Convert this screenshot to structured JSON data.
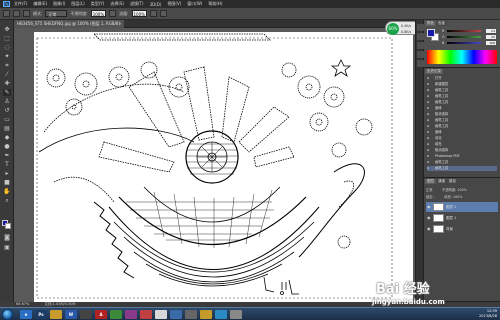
{
  "menubar": {
    "app_icon": "Ps",
    "items": [
      "文件(F)",
      "编辑(E)",
      "图像(I)",
      "图层(L)",
      "类型(Y)",
      "选择(S)",
      "滤镜(T)",
      "3D(D)",
      "视图(V)",
      "窗口(W)",
      "帮助(H)"
    ]
  },
  "options": {
    "label_mode": "模式:",
    "mode_value": "正常",
    "label_opacity": "不透明度:",
    "opacity_value": "100%",
    "label_flow": "流量:",
    "flow_value": "100%"
  },
  "document_tab": {
    "title": "HB3456_ST5 SHEDFNQ.jpg @ 100% (图层 1, RGB/8)",
    "close": "×"
  },
  "status": {
    "zoom": "66.67%",
    "doc_info": "文档:1.03M/3.50M"
  },
  "color_panel": {
    "tabs": [
      "颜色",
      "色板"
    ],
    "sliders": [
      {
        "channel": "R",
        "value": "24",
        "color": "#c04848"
      },
      {
        "channel": "G",
        "value": "20",
        "color": "#48a048"
      },
      {
        "channel": "B",
        "value": "168",
        "color": "#4848c8"
      }
    ]
  },
  "history_panel": {
    "tab": "历史记录",
    "items": [
      {
        "label": "打开",
        "active": false
      },
      {
        "label": "新建图层",
        "active": false
      },
      {
        "label": "画笔工具",
        "active": false
      },
      {
        "label": "画笔工具",
        "active": false
      },
      {
        "label": "画笔工具",
        "active": false
      },
      {
        "label": "魔棒",
        "active": false
      },
      {
        "label": "取消选择",
        "active": false
      },
      {
        "label": "画笔工具",
        "active": false
      },
      {
        "label": "画笔工具",
        "active": false
      },
      {
        "label": "魔棒",
        "active": false
      },
      {
        "label": "羽化",
        "active": false
      },
      {
        "label": "填充",
        "active": false
      },
      {
        "label": "取消选择",
        "active": false
      },
      {
        "label": "Photoshop PDF",
        "active": false
      },
      {
        "label": "画笔工具",
        "active": false
      },
      {
        "label": "画笔工具",
        "active": true
      }
    ]
  },
  "layers_panel": {
    "tabs": [
      "图层",
      "通道",
      "路径"
    ],
    "blend_mode": "正常",
    "opacity_label": "不透明度:",
    "opacity_value": "100%",
    "lock_label": "锁定:",
    "fill_label": "填充:",
    "fill_value": "100%",
    "layers": [
      {
        "name": "图层 2",
        "selected": true
      },
      {
        "name": "图层 1",
        "selected": false
      },
      {
        "name": "背景",
        "selected": false
      }
    ]
  },
  "floating_widget": {
    "badge": "60%",
    "line1": "0.4K/s",
    "line2": "0.8K/s"
  },
  "watermark": {
    "brand": "Bai 经验",
    "url": "jingyan.baidu.com"
  },
  "taskbar": {
    "time": "12:39",
    "date": "2013/8/28",
    "apps": [
      {
        "label": "e",
        "color": "#2a6fc4"
      },
      {
        "label": "Ps",
        "color": "#1b3b66"
      },
      {
        "label": "",
        "color": "#c99a2e"
      },
      {
        "label": "W",
        "color": "#2a57a8"
      },
      {
        "label": "",
        "color": "#444"
      },
      {
        "label": "A",
        "color": "#b22222"
      },
      {
        "label": "",
        "color": "#3a8a3a"
      },
      {
        "label": "",
        "color": "#8a3a8a"
      },
      {
        "label": "",
        "color": "#c04040"
      },
      {
        "label": "",
        "color": "#d8d8d8"
      },
      {
        "label": "",
        "color": "#3a6aaa"
      },
      {
        "label": "",
        "color": "#666"
      },
      {
        "label": "",
        "color": "#c49a2a"
      },
      {
        "label": "",
        "color": "#2a8ac4"
      },
      {
        "label": "",
        "color": "#888"
      }
    ]
  }
}
